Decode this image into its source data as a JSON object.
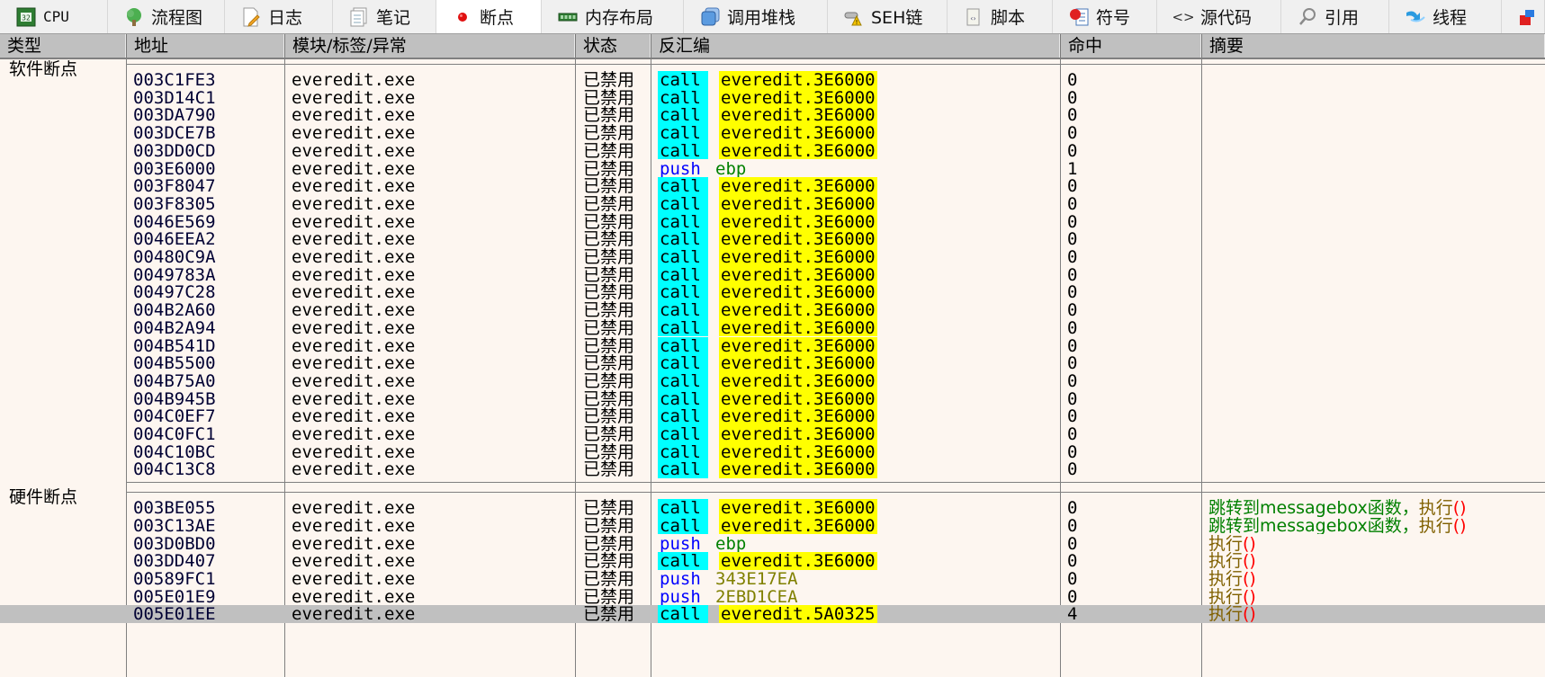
{
  "tabs": [
    {
      "label": "CPU",
      "icon": "cpu-chip-icon",
      "active": false
    },
    {
      "label": "流程图",
      "icon": "tree-icon",
      "active": false
    },
    {
      "label": "日志",
      "icon": "log-pencil-icon",
      "active": false
    },
    {
      "label": "笔记",
      "icon": "notes-icon",
      "active": false
    },
    {
      "label": "断点",
      "icon": "breakpoint-dot-icon",
      "active": true
    },
    {
      "label": "内存布局",
      "icon": "memory-icon",
      "active": false
    },
    {
      "label": "调用堆栈",
      "icon": "call-stack-icon",
      "active": false
    },
    {
      "label": "SEH链",
      "icon": "seh-chain-icon",
      "active": false
    },
    {
      "label": "脚本",
      "icon": "script-icon",
      "active": false
    },
    {
      "label": "符号",
      "icon": "symbols-icon",
      "active": false
    },
    {
      "label": "源代码",
      "icon": "source-code-icon",
      "active": false
    },
    {
      "label": "引用",
      "icon": "references-icon",
      "active": false
    },
    {
      "label": "线程",
      "icon": "threads-icon",
      "active": false
    },
    {
      "label": "",
      "icon": "handles-icon",
      "active": false
    }
  ],
  "columns": {
    "type": "类型",
    "address": "地址",
    "module": "模块/标签/异常",
    "state": "状态",
    "disasm": "反汇编",
    "hits": "命中",
    "summary": "摘要"
  },
  "groups": [
    {
      "label": "软件断点",
      "rows": [
        {
          "address": "003C1FE3",
          "module": "everedit.exe",
          "state": "已禁用",
          "mnemonic": "call",
          "operand": "everedit.3E6000",
          "operand_type": "target",
          "hits": "0",
          "summary": []
        },
        {
          "address": "003D14C1",
          "module": "everedit.exe",
          "state": "已禁用",
          "mnemonic": "call",
          "operand": "everedit.3E6000",
          "operand_type": "target",
          "hits": "0",
          "summary": []
        },
        {
          "address": "003DA790",
          "module": "everedit.exe",
          "state": "已禁用",
          "mnemonic": "call",
          "operand": "everedit.3E6000",
          "operand_type": "target",
          "hits": "0",
          "summary": []
        },
        {
          "address": "003DCE7B",
          "module": "everedit.exe",
          "state": "已禁用",
          "mnemonic": "call",
          "operand": "everedit.3E6000",
          "operand_type": "target",
          "hits": "0",
          "summary": []
        },
        {
          "address": "003DD0CD",
          "module": "everedit.exe",
          "state": "已禁用",
          "mnemonic": "call",
          "operand": "everedit.3E6000",
          "operand_type": "target",
          "hits": "0",
          "summary": []
        },
        {
          "address": "003E6000",
          "module": "everedit.exe",
          "state": "已禁用",
          "mnemonic": "push",
          "operand": "ebp",
          "operand_type": "register",
          "hits": "1",
          "summary": []
        },
        {
          "address": "003F8047",
          "module": "everedit.exe",
          "state": "已禁用",
          "mnemonic": "call",
          "operand": "everedit.3E6000",
          "operand_type": "target",
          "hits": "0",
          "summary": []
        },
        {
          "address": "003F8305",
          "module": "everedit.exe",
          "state": "已禁用",
          "mnemonic": "call",
          "operand": "everedit.3E6000",
          "operand_type": "target",
          "hits": "0",
          "summary": []
        },
        {
          "address": "0046E569",
          "module": "everedit.exe",
          "state": "已禁用",
          "mnemonic": "call",
          "operand": "everedit.3E6000",
          "operand_type": "target",
          "hits": "0",
          "summary": []
        },
        {
          "address": "0046EEA2",
          "module": "everedit.exe",
          "state": "已禁用",
          "mnemonic": "call",
          "operand": "everedit.3E6000",
          "operand_type": "target",
          "hits": "0",
          "summary": []
        },
        {
          "address": "00480C9A",
          "module": "everedit.exe",
          "state": "已禁用",
          "mnemonic": "call",
          "operand": "everedit.3E6000",
          "operand_type": "target",
          "hits": "0",
          "summary": []
        },
        {
          "address": "0049783A",
          "module": "everedit.exe",
          "state": "已禁用",
          "mnemonic": "call",
          "operand": "everedit.3E6000",
          "operand_type": "target",
          "hits": "0",
          "summary": []
        },
        {
          "address": "00497C28",
          "module": "everedit.exe",
          "state": "已禁用",
          "mnemonic": "call",
          "operand": "everedit.3E6000",
          "operand_type": "target",
          "hits": "0",
          "summary": []
        },
        {
          "address": "004B2A60",
          "module": "everedit.exe",
          "state": "已禁用",
          "mnemonic": "call",
          "operand": "everedit.3E6000",
          "operand_type": "target",
          "hits": "0",
          "summary": []
        },
        {
          "address": "004B2A94",
          "module": "everedit.exe",
          "state": "已禁用",
          "mnemonic": "call",
          "operand": "everedit.3E6000",
          "operand_type": "target",
          "hits": "0",
          "summary": []
        },
        {
          "address": "004B541D",
          "module": "everedit.exe",
          "state": "已禁用",
          "mnemonic": "call",
          "operand": "everedit.3E6000",
          "operand_type": "target",
          "hits": "0",
          "summary": []
        },
        {
          "address": "004B5500",
          "module": "everedit.exe",
          "state": "已禁用",
          "mnemonic": "call",
          "operand": "everedit.3E6000",
          "operand_type": "target",
          "hits": "0",
          "summary": []
        },
        {
          "address": "004B75A0",
          "module": "everedit.exe",
          "state": "已禁用",
          "mnemonic": "call",
          "operand": "everedit.3E6000",
          "operand_type": "target",
          "hits": "0",
          "summary": []
        },
        {
          "address": "004B945B",
          "module": "everedit.exe",
          "state": "已禁用",
          "mnemonic": "call",
          "operand": "everedit.3E6000",
          "operand_type": "target",
          "hits": "0",
          "summary": []
        },
        {
          "address": "004C0EF7",
          "module": "everedit.exe",
          "state": "已禁用",
          "mnemonic": "call",
          "operand": "everedit.3E6000",
          "operand_type": "target",
          "hits": "0",
          "summary": []
        },
        {
          "address": "004C0FC1",
          "module": "everedit.exe",
          "state": "已禁用",
          "mnemonic": "call",
          "operand": "everedit.3E6000",
          "operand_type": "target",
          "hits": "0",
          "summary": []
        },
        {
          "address": "004C10BC",
          "module": "everedit.exe",
          "state": "已禁用",
          "mnemonic": "call",
          "operand": "everedit.3E6000",
          "operand_type": "target",
          "hits": "0",
          "summary": []
        },
        {
          "address": "004C13C8",
          "module": "everedit.exe",
          "state": "已禁用",
          "mnemonic": "call",
          "operand": "everedit.3E6000",
          "operand_type": "target",
          "hits": "0",
          "summary": []
        }
      ]
    },
    {
      "label": "硬件断点",
      "rows": [
        {
          "address": "003BE055",
          "module": "everedit.exe",
          "state": "已禁用",
          "mnemonic": "call",
          "operand": "everedit.3E6000",
          "operand_type": "target",
          "hits": "0",
          "summary": [
            {
              "text": "跳转到messagebox函数，",
              "kind": "comment"
            },
            {
              "text": "执行",
              "kind": "exec"
            },
            {
              "text": "()",
              "kind": "paren"
            }
          ]
        },
        {
          "address": "003C13AE",
          "module": "everedit.exe",
          "state": "已禁用",
          "mnemonic": "call",
          "operand": "everedit.3E6000",
          "operand_type": "target",
          "hits": "0",
          "summary": [
            {
              "text": "跳转到messagebox函数，",
              "kind": "comment"
            },
            {
              "text": "执行",
              "kind": "exec"
            },
            {
              "text": "()",
              "kind": "paren"
            }
          ]
        },
        {
          "address": "003D0BD0",
          "module": "everedit.exe",
          "state": "已禁用",
          "mnemonic": "push",
          "operand": "ebp",
          "operand_type": "register",
          "hits": "0",
          "summary": [
            {
              "text": "执行",
              "kind": "exec"
            },
            {
              "text": "()",
              "kind": "paren"
            }
          ]
        },
        {
          "address": "003DD407",
          "module": "everedit.exe",
          "state": "已禁用",
          "mnemonic": "call",
          "operand": "everedit.3E6000",
          "operand_type": "target",
          "hits": "0",
          "summary": [
            {
              "text": "执行",
              "kind": "exec"
            },
            {
              "text": "()",
              "kind": "paren"
            }
          ]
        },
        {
          "address": "00589FC1",
          "module": "everedit.exe",
          "state": "已禁用",
          "mnemonic": "push",
          "operand": "343E17EA",
          "operand_type": "immediate",
          "hits": "0",
          "summary": [
            {
              "text": "执行",
              "kind": "exec"
            },
            {
              "text": "()",
              "kind": "paren"
            }
          ]
        },
        {
          "address": "005E01E9",
          "module": "everedit.exe",
          "state": "已禁用",
          "mnemonic": "push",
          "operand": "2EBD1CEA",
          "operand_type": "immediate",
          "hits": "0",
          "summary": [
            {
              "text": "执行",
              "kind": "exec"
            },
            {
              "text": "()",
              "kind": "paren"
            }
          ]
        },
        {
          "address": "005E01EE",
          "module": "everedit.exe",
          "state": "已禁用",
          "mnemonic": "call",
          "operand": "everedit.5A0325",
          "operand_type": "target",
          "hits": "4",
          "selected": true,
          "summary": [
            {
              "text": "执行",
              "kind": "exec"
            },
            {
              "text": "()",
              "kind": "paren"
            }
          ]
        }
      ]
    }
  ],
  "colors": {
    "mnemonic_call_bg": "#00ffff",
    "call_target_bg": "#ffff00",
    "push_mnemonic": "#0000ff",
    "register": "#008000",
    "immediate": "#808000",
    "comment": "#008000",
    "selected_row_bg": "#c0c0c0",
    "table_bg": "#fdf6f0"
  }
}
